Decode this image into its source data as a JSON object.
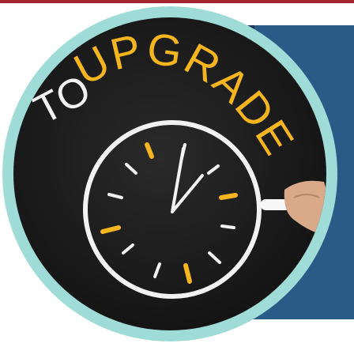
{
  "colors": {
    "top_strip": "#a3262c",
    "panel_dark": "#1c3658",
    "panel_blue": "#2a5a86",
    "ring": "#9fdcd8",
    "chalkboard": "#141414",
    "chalk_white": "#f2f2f2",
    "chalk_yellow": "#f5b51f"
  },
  "image": {
    "subject": "chalk-clock-upgrade",
    "text_white": "TO",
    "text_yellow": "UPGRADE"
  }
}
